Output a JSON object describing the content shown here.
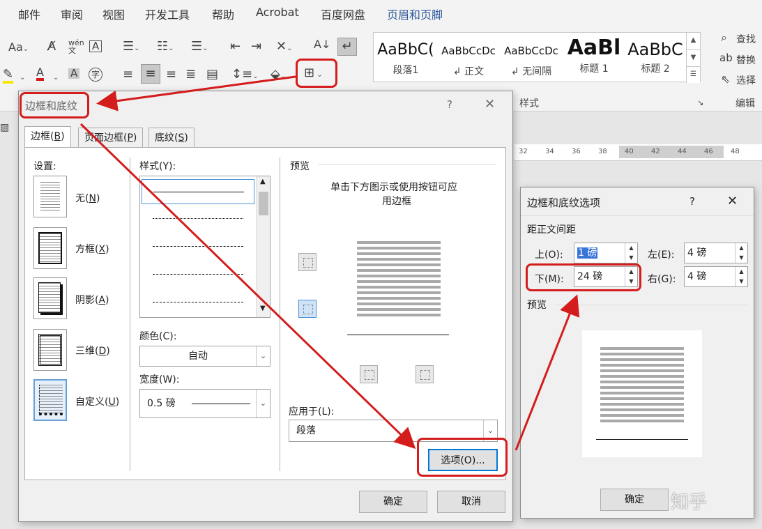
{
  "menu_items": [
    "邮件",
    "审阅",
    "视图",
    "开发工具",
    "帮助",
    "Acrobat",
    "百度网盘",
    "页眉和页脚"
  ],
  "ribbon": {
    "right_tools": [
      "查找",
      "替换",
      "选择"
    ],
    "styles": [
      {
        "sample": "AaBbC(",
        "name": "段落1"
      },
      {
        "sample": "AaBbCcDc",
        "name": "↲ 正文"
      },
      {
        "sample": "AaBbCcDc",
        "name": "↲ 无间隔"
      },
      {
        "sample": "AaBl",
        "name": "标题 1"
      },
      {
        "sample": "AaBbC",
        "name": "标题 2"
      }
    ],
    "group_styles_label": "样式",
    "group_edit_label": "编辑"
  },
  "ruler": {
    "ticks": [
      "32",
      "34",
      "36",
      "38",
      "40",
      "42",
      "44",
      "46",
      "48"
    ]
  },
  "border_dialog": {
    "title": "边框和底纹",
    "help": "?",
    "close": "✕",
    "tabs": [
      {
        "label": "边框",
        "key": "B"
      },
      {
        "label": "页面边框",
        "key": "P"
      },
      {
        "label": "底纹",
        "key": "S"
      }
    ],
    "settings_label": "设置:",
    "settings": [
      {
        "label": "无",
        "key": "N"
      },
      {
        "label": "方框",
        "key": "X"
      },
      {
        "label": "阴影",
        "key": "A"
      },
      {
        "label": "三维",
        "key": "D"
      },
      {
        "label": "自定义",
        "key": "U"
      }
    ],
    "style_label": "样式(Y):",
    "color_label": "颜色(C):",
    "color_value": "自动",
    "width_label": "宽度(W):",
    "width_value": "0.5 磅",
    "preview_label": "预览",
    "preview_hint_line1": "单击下方图示或使用按钮可应",
    "preview_hint_line2": "用边框",
    "apply_label": "应用于(L):",
    "apply_value": "段落",
    "options_button": "选项(O)...",
    "ok_button": "确定",
    "cancel_button": "取消"
  },
  "options_dialog": {
    "title": "边框和底纹选项",
    "help": "?",
    "close": "✕",
    "spacing_label": "距正文间距",
    "top_label": "上(O):",
    "top_value": "1 磅",
    "bottom_label": "下(M):",
    "bottom_value": "24 磅",
    "left_label": "左(E):",
    "left_value": "4 磅",
    "right_label": "右(G):",
    "right_value": "4 磅",
    "preview_label": "预览",
    "ok_button": "确定"
  },
  "watermark": "知乎"
}
